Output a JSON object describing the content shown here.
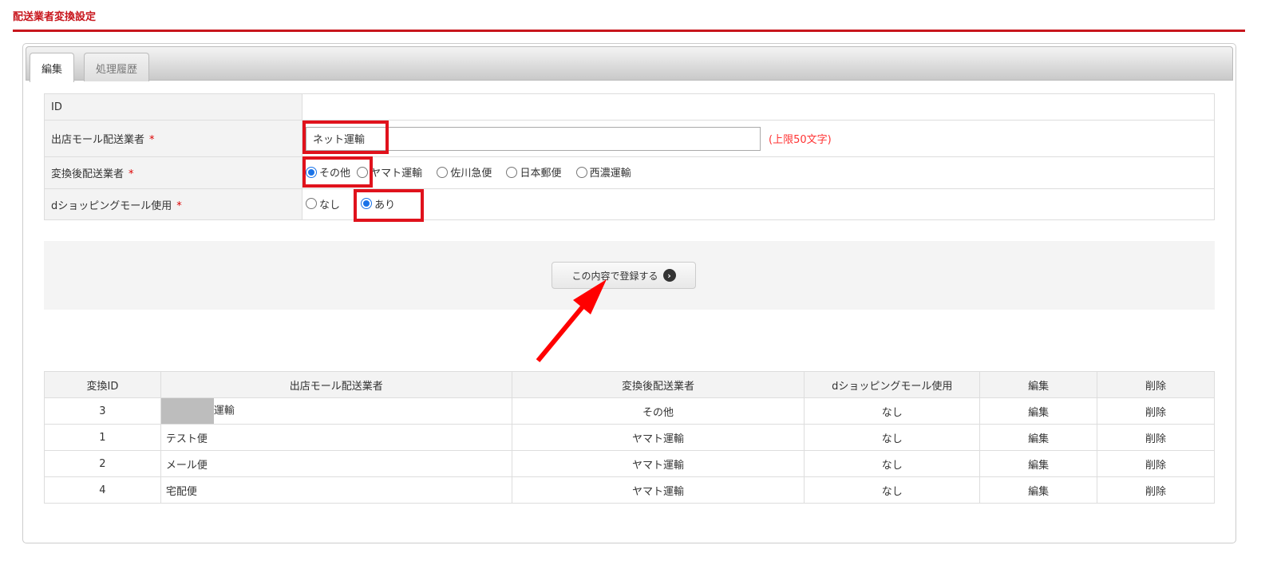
{
  "page_title": "配送業者変換設定",
  "tabs": [
    {
      "label": "編集",
      "active": true
    },
    {
      "label": "処理履歴",
      "active": false
    }
  ],
  "form": {
    "id_label": "ID",
    "id_value": "",
    "mall_carrier_label": "出店モール配送業者",
    "mall_carrier_value": "ネット運輸",
    "mall_carrier_hint": "(上限50文字)",
    "converted_carrier_label": "変換後配送業者",
    "converted_options": [
      "その他",
      "ヤマト運輸",
      "佐川急便",
      "日本郵便",
      "西濃運輸"
    ],
    "converted_selected": "その他",
    "dshopping_label": "dショッピングモール使用",
    "dshopping_options": [
      "なし",
      "あり"
    ],
    "dshopping_selected": "あり",
    "required_mark": "*"
  },
  "submit_label": "この内容で登録する",
  "list": {
    "headers": [
      "変換ID",
      "出店モール配送業者",
      "変換後配送業者",
      "dショッピングモール使用",
      "編集",
      "削除"
    ],
    "rows": [
      {
        "id": "3",
        "mall": "運輸",
        "converted": "その他",
        "dshopping": "なし",
        "edit": "編集",
        "delete": "削除"
      },
      {
        "id": "1",
        "mall": "テスト便",
        "converted": "ヤマト運輸",
        "dshopping": "なし",
        "edit": "編集",
        "delete": "削除"
      },
      {
        "id": "2",
        "mall": "メール便",
        "converted": "ヤマト運輸",
        "dshopping": "なし",
        "edit": "編集",
        "delete": "削除"
      },
      {
        "id": "4",
        "mall": "宅配便",
        "converted": "ヤマト運輸",
        "dshopping": "なし",
        "edit": "編集",
        "delete": "削除"
      }
    ]
  },
  "colors": {
    "accent": "#c8161d",
    "highlight": "#e0121c",
    "radio": "#1a73e8"
  }
}
